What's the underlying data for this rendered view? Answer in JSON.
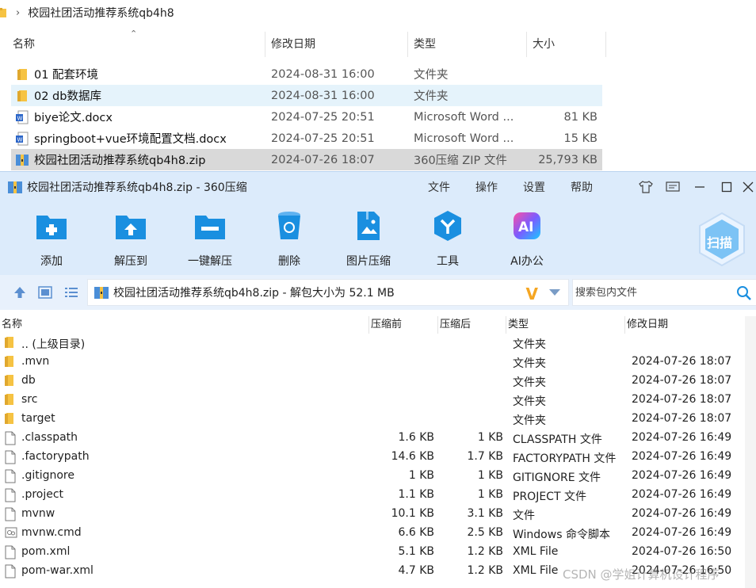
{
  "explorer": {
    "path": "校园社团活动推荐系统qb4h8",
    "columns": {
      "name": "名称",
      "modified": "修改日期",
      "type": "类型",
      "size": "大小"
    },
    "rows": [
      {
        "name": "01 配套环境",
        "date": "2024-08-31 16:00",
        "type": "文件夹",
        "size": "",
        "icon": "folder-icon"
      },
      {
        "name": "02 db数据库",
        "date": "2024-08-31 16:00",
        "type": "文件夹",
        "size": "",
        "icon": "folder-icon"
      },
      {
        "name": "biye论文.docx",
        "date": "2024-07-25 20:51",
        "type": "Microsoft Word ...",
        "size": "81 KB",
        "icon": "word-doc-icon"
      },
      {
        "name": "springboot+vue环境配置文档.docx",
        "date": "2024-07-25 20:51",
        "type": "Microsoft Word ...",
        "size": "15 KB",
        "icon": "word-doc-icon"
      },
      {
        "name": "校园社团活动推荐系统qb4h8.zip",
        "date": "2024-07-26 18:07",
        "type": "360压缩 ZIP 文件",
        "size": "25,793 KB",
        "icon": "zip-archive-icon"
      }
    ]
  },
  "zip": {
    "title": "校园社团活动推荐系统qb4h8.zip - 360压缩",
    "menus": [
      "文件",
      "操作",
      "设置",
      "帮助"
    ],
    "toolbar": [
      "添加",
      "解压到",
      "一键解压",
      "删除",
      "图片压缩",
      "工具",
      "AI办公"
    ],
    "scan_label": "扫描",
    "address": "校园社团活动推荐系统qb4h8.zip - 解包大小为 52.1 MB",
    "search_placeholder": "搜索包内文件",
    "columns": {
      "name": "名称",
      "size": "压缩前",
      "compressed": "压缩后",
      "type": "类型",
      "modified": "修改日期"
    },
    "rows": [
      {
        "name": ".. (上级目录)",
        "size": "",
        "compressed": "",
        "type": "文件夹",
        "date": "",
        "icon": "folder-icon"
      },
      {
        "name": ".mvn",
        "size": "",
        "compressed": "",
        "type": "文件夹",
        "date": "2024-07-26 18:07",
        "icon": "folder-icon"
      },
      {
        "name": "db",
        "size": "",
        "compressed": "",
        "type": "文件夹",
        "date": "2024-07-26 18:07",
        "icon": "folder-icon"
      },
      {
        "name": "src",
        "size": "",
        "compressed": "",
        "type": "文件夹",
        "date": "2024-07-26 18:07",
        "icon": "folder-icon"
      },
      {
        "name": "target",
        "size": "",
        "compressed": "",
        "type": "文件夹",
        "date": "2024-07-26 18:07",
        "icon": "folder-icon"
      },
      {
        "name": ".classpath",
        "size": "1.6 KB",
        "compressed": "1 KB",
        "type": "CLASSPATH 文件",
        "date": "2024-07-26 16:49",
        "icon": "file-icon"
      },
      {
        "name": ".factorypath",
        "size": "14.6 KB",
        "compressed": "1.7 KB",
        "type": "FACTORYPATH 文件",
        "date": "2024-07-26 16:49",
        "icon": "file-icon"
      },
      {
        "name": ".gitignore",
        "size": "1 KB",
        "compressed": "1 KB",
        "type": "GITIGNORE 文件",
        "date": "2024-07-26 16:49",
        "icon": "file-icon"
      },
      {
        "name": ".project",
        "size": "1.1 KB",
        "compressed": "1 KB",
        "type": "PROJECT 文件",
        "date": "2024-07-26 16:49",
        "icon": "file-icon"
      },
      {
        "name": "mvnw",
        "size": "10.1 KB",
        "compressed": "3.1 KB",
        "type": "文件",
        "date": "2024-07-26 16:49",
        "icon": "file-icon"
      },
      {
        "name": "mvnw.cmd",
        "size": "6.6 KB",
        "compressed": "2.5 KB",
        "type": "Windows 命令脚本",
        "date": "2024-07-26 16:49",
        "icon": "cmd-script-icon"
      },
      {
        "name": "pom.xml",
        "size": "5.1 KB",
        "compressed": "1.2 KB",
        "type": "XML File",
        "date": "2024-07-26 16:50",
        "icon": "file-icon"
      },
      {
        "name": "pom-war.xml",
        "size": "4.7 KB",
        "compressed": "1.2 KB",
        "type": "XML File",
        "date": "2024-07-26 16:50",
        "icon": "file-icon"
      }
    ]
  },
  "watermark": "CSDN @学姐计算机设计程序",
  "colors": {
    "title_bg": "#dcebfb",
    "address_bg": "#e8f1fc",
    "folder": "#f6c343",
    "accent_blue": "#1a8fe0",
    "selection_light": "#e5f3fb",
    "selection_gray": "#d9d9d9"
  }
}
